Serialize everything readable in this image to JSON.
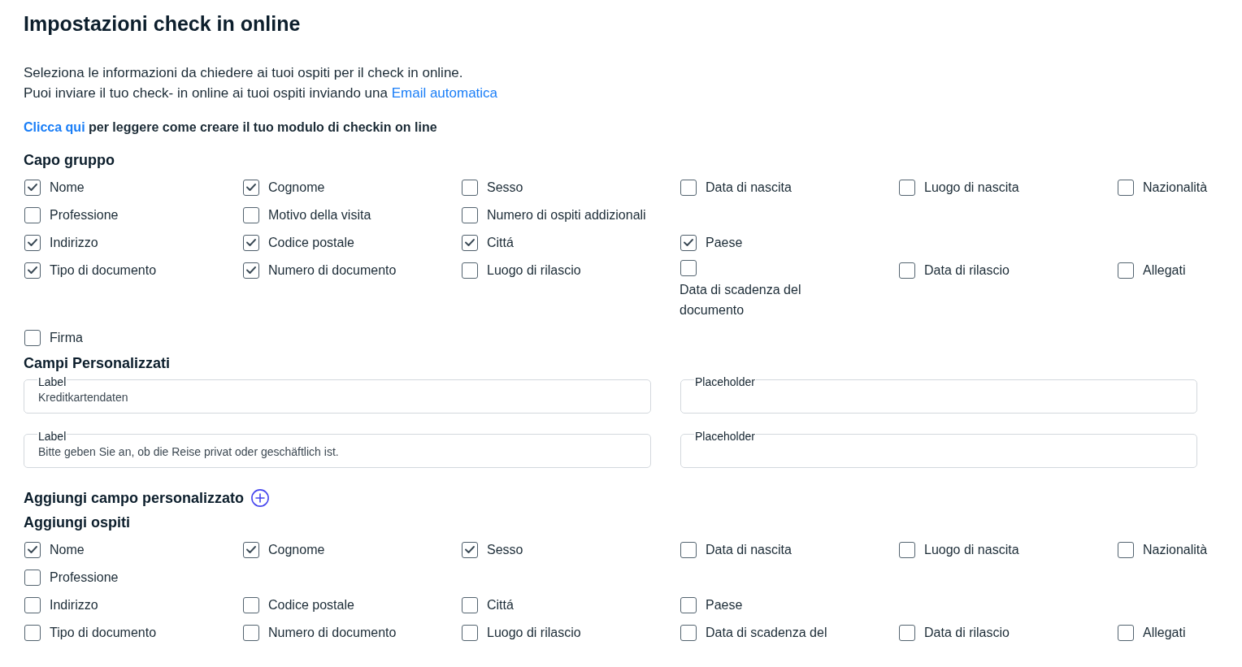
{
  "page": {
    "title": "Impostazioni check in online"
  },
  "intro": [
    {
      "text": "Seleziona le informazioni da chiedere ai tuoi ospiti per il check in online."
    },
    {
      "text": "Puoi inviare il tuo check- in online ai tuoi ospiti inviando una",
      "link": "Email automatica"
    }
  ],
  "help": {
    "link": "Clicca qui",
    "text": "per leggere come creare il tuo modulo di checkin on line"
  },
  "lead_guest": {
    "title": "Capo gruppo",
    "rows": [
      [
        {
          "label": "Nome",
          "checked": true
        },
        {
          "label": "Cognome",
          "checked": true
        },
        {
          "label": "Sesso",
          "checked": false
        },
        {
          "label": "Data di nascita",
          "checked": false
        },
        {
          "label": "Luogo di nascita",
          "checked": false
        },
        {
          "label": "Nazionalità",
          "checked": false
        }
      ],
      [
        {
          "label": "Professione",
          "checked": false
        },
        {
          "label": "Motivo della visita",
          "checked": false
        },
        {
          "label": "Numero di ospiti addizionali",
          "checked": false
        }
      ],
      [
        {
          "label": "Indirizzo",
          "checked": true
        },
        {
          "label": "Codice postale",
          "checked": true
        },
        {
          "label": "Cittá",
          "checked": true
        },
        {
          "label": "Paese",
          "checked": true
        }
      ],
      [
        {
          "label": "Tipo di documento",
          "checked": true
        },
        {
          "label": "Numero di documento",
          "checked": true
        },
        {
          "label": "Luogo di rilascio",
          "checked": false
        },
        {
          "label": "Data di scadenza del documento",
          "checked": false
        },
        {
          "label": "Data di rilascio",
          "checked": false
        },
        {
          "label": "Allegati",
          "checked": false
        }
      ],
      [
        {
          "label": "Firma",
          "checked": false
        }
      ]
    ]
  },
  "custom_fields": {
    "title": "Campi Personalizzati",
    "items": [
      {
        "label_field": {
          "legend": "Label",
          "value": "Kreditkartendaten"
        },
        "hint_field": {
          "legend": "Placeholder"
        }
      },
      {
        "label_field": {
          "legend": "Label",
          "value": "Bitte geben Sie an, ob die Reise privat oder geschäftlich ist."
        },
        "hint_field": {
          "legend": "Placeholder"
        }
      }
    ]
  },
  "add_custom_field": {
    "text": "Aggiungi campo personalizzato"
  },
  "guests": {
    "title": "Aggiungi ospiti",
    "rows": [
      [
        {
          "label": "Nome",
          "checked": true
        },
        {
          "label": "Cognome",
          "checked": true
        },
        {
          "label": "Sesso",
          "checked": true
        },
        {
          "label": "Data di nascita",
          "checked": false
        },
        {
          "label": "Luogo di nascita",
          "checked": false
        },
        {
          "label": "Nazionalità",
          "checked": false
        }
      ],
      [
        {
          "label": "Professione",
          "checked": false
        }
      ],
      [
        {
          "label": "Indirizzo",
          "checked": false
        },
        {
          "label": "Codice postale",
          "checked": false
        },
        {
          "label": "Cittá",
          "checked": false
        },
        {
          "label": "Paese",
          "checked": false
        }
      ],
      [
        {
          "label": "Tipo di documento",
          "checked": false
        },
        {
          "label": "Numero di documento",
          "checked": false
        },
        {
          "label": "Luogo di rilascio",
          "checked": false
        },
        {
          "label": "Data di scadenza del",
          "checked": false
        },
        {
          "label": "Data di rilascio",
          "checked": false
        },
        {
          "label": "Allegati",
          "checked": false
        }
      ]
    ]
  }
}
